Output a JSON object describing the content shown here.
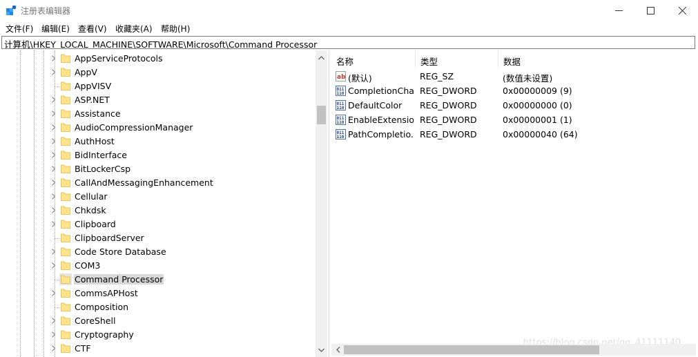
{
  "window": {
    "title": "注册表编辑器",
    "icon": "registry-editor-icon"
  },
  "menu": [
    "文件(F)",
    "编辑(E)",
    "查看(V)",
    "收藏夹(A)",
    "帮助(H)"
  ],
  "address": "计算机\\HKEY_LOCAL_MACHINE\\SOFTWARE\\Microsoft\\Command Processor",
  "tree": {
    "items": [
      {
        "label": "AppServiceProtocols",
        "expandable": true,
        "selected": false
      },
      {
        "label": "AppV",
        "expandable": true,
        "selected": false
      },
      {
        "label": "AppVISV",
        "expandable": false,
        "selected": false
      },
      {
        "label": "ASP.NET",
        "expandable": true,
        "selected": false
      },
      {
        "label": "Assistance",
        "expandable": true,
        "selected": false
      },
      {
        "label": "AudioCompressionManager",
        "expandable": true,
        "selected": false
      },
      {
        "label": "AuthHost",
        "expandable": true,
        "selected": false
      },
      {
        "label": "BidInterface",
        "expandable": true,
        "selected": false
      },
      {
        "label": "BitLockerCsp",
        "expandable": true,
        "selected": false
      },
      {
        "label": "CallAndMessagingEnhancement",
        "expandable": true,
        "selected": false
      },
      {
        "label": "Cellular",
        "expandable": true,
        "selected": false
      },
      {
        "label": "Chkdsk",
        "expandable": true,
        "selected": false
      },
      {
        "label": "Clipboard",
        "expandable": true,
        "selected": false
      },
      {
        "label": "ClipboardServer",
        "expandable": false,
        "selected": false
      },
      {
        "label": "Code Store Database",
        "expandable": true,
        "selected": false
      },
      {
        "label": "COM3",
        "expandable": true,
        "selected": false
      },
      {
        "label": "Command Processor",
        "expandable": false,
        "selected": true
      },
      {
        "label": "CommsAPHost",
        "expandable": true,
        "selected": false
      },
      {
        "label": "Composition",
        "expandable": false,
        "selected": false
      },
      {
        "label": "CoreShell",
        "expandable": true,
        "selected": false
      },
      {
        "label": "Cryptography",
        "expandable": true,
        "selected": false
      },
      {
        "label": "CTF",
        "expandable": true,
        "selected": false
      }
    ]
  },
  "values": {
    "columns": {
      "name": "名称",
      "type": "类型",
      "data": "数据"
    },
    "rows": [
      {
        "icon": "string-value-icon",
        "name": "(默认)",
        "type": "REG_SZ",
        "data": "(数值未设置)"
      },
      {
        "icon": "dword-value-icon",
        "name": "CompletionChar",
        "type": "REG_DWORD",
        "data": "0x00000009 (9)"
      },
      {
        "icon": "dword-value-icon",
        "name": "DefaultColor",
        "type": "REG_DWORD",
        "data": "0x00000000 (0)"
      },
      {
        "icon": "dword-value-icon",
        "name": "EnableExtensio...",
        "type": "REG_DWORD",
        "data": "0x00000001 (1)"
      },
      {
        "icon": "dword-value-icon",
        "name": "PathCompletio...",
        "type": "REG_DWORD",
        "data": "0x00000040 (64)"
      }
    ]
  },
  "watermark": "https://blog.csdn.net/qq_41111140"
}
